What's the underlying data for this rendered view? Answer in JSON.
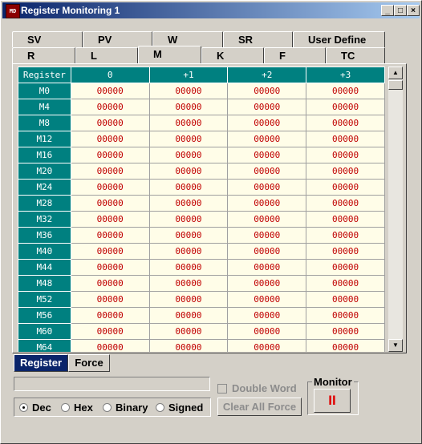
{
  "window": {
    "title": "Register Monitoring 1",
    "app_icon_text": "MD",
    "controls": {
      "minimize": "_",
      "maximize": "□",
      "close": "×"
    }
  },
  "tabs_row1": [
    {
      "label": "SV"
    },
    {
      "label": "PV"
    },
    {
      "label": "W"
    },
    {
      "label": "SR"
    },
    {
      "label": "User Define"
    }
  ],
  "tabs_row2": [
    {
      "label": "R"
    },
    {
      "label": "L"
    },
    {
      "label": "M",
      "active": true
    },
    {
      "label": "K"
    },
    {
      "label": "F"
    },
    {
      "label": "TC"
    }
  ],
  "table": {
    "headers": [
      "Register",
      "0",
      "+1",
      "+2",
      "+3"
    ],
    "rows": [
      {
        "register": "M0",
        "values": [
          "00000",
          "00000",
          "00000",
          "00000"
        ]
      },
      {
        "register": "M4",
        "values": [
          "00000",
          "00000",
          "00000",
          "00000"
        ]
      },
      {
        "register": "M8",
        "values": [
          "00000",
          "00000",
          "00000",
          "00000"
        ]
      },
      {
        "register": "M12",
        "values": [
          "00000",
          "00000",
          "00000",
          "00000"
        ]
      },
      {
        "register": "M16",
        "values": [
          "00000",
          "00000",
          "00000",
          "00000"
        ]
      },
      {
        "register": "M20",
        "values": [
          "00000",
          "00000",
          "00000",
          "00000"
        ]
      },
      {
        "register": "M24",
        "values": [
          "00000",
          "00000",
          "00000",
          "00000"
        ]
      },
      {
        "register": "M28",
        "values": [
          "00000",
          "00000",
          "00000",
          "00000"
        ]
      },
      {
        "register": "M32",
        "values": [
          "00000",
          "00000",
          "00000",
          "00000"
        ]
      },
      {
        "register": "M36",
        "values": [
          "00000",
          "00000",
          "00000",
          "00000"
        ]
      },
      {
        "register": "M40",
        "values": [
          "00000",
          "00000",
          "00000",
          "00000"
        ]
      },
      {
        "register": "M44",
        "values": [
          "00000",
          "00000",
          "00000",
          "00000"
        ]
      },
      {
        "register": "M48",
        "values": [
          "00000",
          "00000",
          "00000",
          "00000"
        ]
      },
      {
        "register": "M52",
        "values": [
          "00000",
          "00000",
          "00000",
          "00000"
        ]
      },
      {
        "register": "M56",
        "values": [
          "00000",
          "00000",
          "00000",
          "00000"
        ]
      },
      {
        "register": "M60",
        "values": [
          "00000",
          "00000",
          "00000",
          "00000"
        ]
      },
      {
        "register": "M64",
        "values": [
          "00000",
          "00000",
          "00000",
          "00000"
        ]
      }
    ]
  },
  "scrollbar": {
    "up": "▲",
    "down": "▼"
  },
  "bottom_tabs": [
    {
      "label": "Register",
      "active": true
    },
    {
      "label": "Force",
      "active": false
    }
  ],
  "format_options": [
    {
      "label": "Dec",
      "selected": true
    },
    {
      "label": "Hex",
      "selected": false
    },
    {
      "label": "Binary",
      "selected": false
    },
    {
      "label": "Signed",
      "selected": false
    }
  ],
  "double_word": {
    "label": "Double Word",
    "checked": false,
    "enabled": false
  },
  "clear_all_force": {
    "label": "Clear All Force",
    "enabled": false
  },
  "monitor": {
    "label": "Monitor",
    "button_symbol": "II"
  },
  "colors": {
    "header_bg": "#008080",
    "value_text": "#c00000",
    "cell_bg": "#fffde8",
    "title_bar": "#0a246a"
  }
}
